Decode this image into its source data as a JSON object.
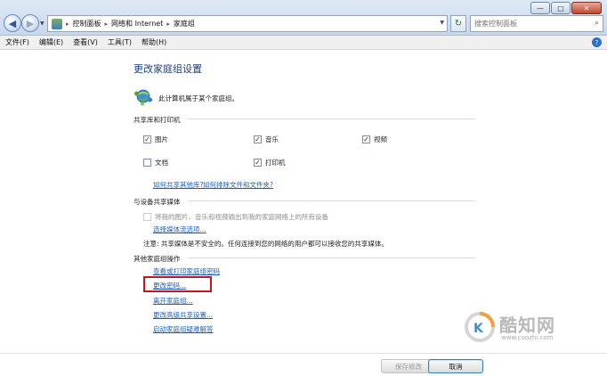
{
  "window": {
    "minimize": "—",
    "maximize": "□",
    "close": "✕"
  },
  "address_bar": {
    "crumbs": [
      "控制面板",
      "网络和 Internet",
      "家庭组"
    ],
    "separator": "▸"
  },
  "search": {
    "placeholder": "搜索控制面板"
  },
  "menu": [
    "文件(F)",
    "编辑(E)",
    "查看(V)",
    "工具(T)",
    "帮助(H)"
  ],
  "page": {
    "title": "更改家庭组设置",
    "status": "此计算机属于某个家庭组。"
  },
  "sharing": {
    "title": "共享库和打印机",
    "items": [
      {
        "label": "图片",
        "checked": true
      },
      {
        "label": "音乐",
        "checked": true
      },
      {
        "label": "视频",
        "checked": true
      },
      {
        "label": "文档",
        "checked": false
      },
      {
        "label": "打印机",
        "checked": true
      }
    ],
    "link_libraries": "如何共享其他库?",
    "link_exclude": "如何排除文件和文件夹?"
  },
  "media": {
    "title": "与设备共享媒体",
    "stream_label": "将我的图片、音乐和视频输出到我的家庭网络上的所有设备",
    "stream_checked": false,
    "choose_link": "选择媒体流选项...",
    "note": "注意: 共享媒体是不安全的。任何连接到您的网络的用户都可以接收您的共享媒体。"
  },
  "other": {
    "title": "其他家庭组操作",
    "links": [
      "查看或打印家庭组密码",
      "更改密码...",
      "离开家庭组...",
      "更改高级共享设置...",
      "启动家庭组疑难解答"
    ]
  },
  "watermark": {
    "name": "酷知网",
    "url": "www.coozhi.com"
  },
  "buttons": {
    "save": "保存修改",
    "cancel": "取消"
  },
  "colors": {
    "link": "#1d5fb8",
    "title": "#1a3d89",
    "highlight": "#c4161c"
  }
}
